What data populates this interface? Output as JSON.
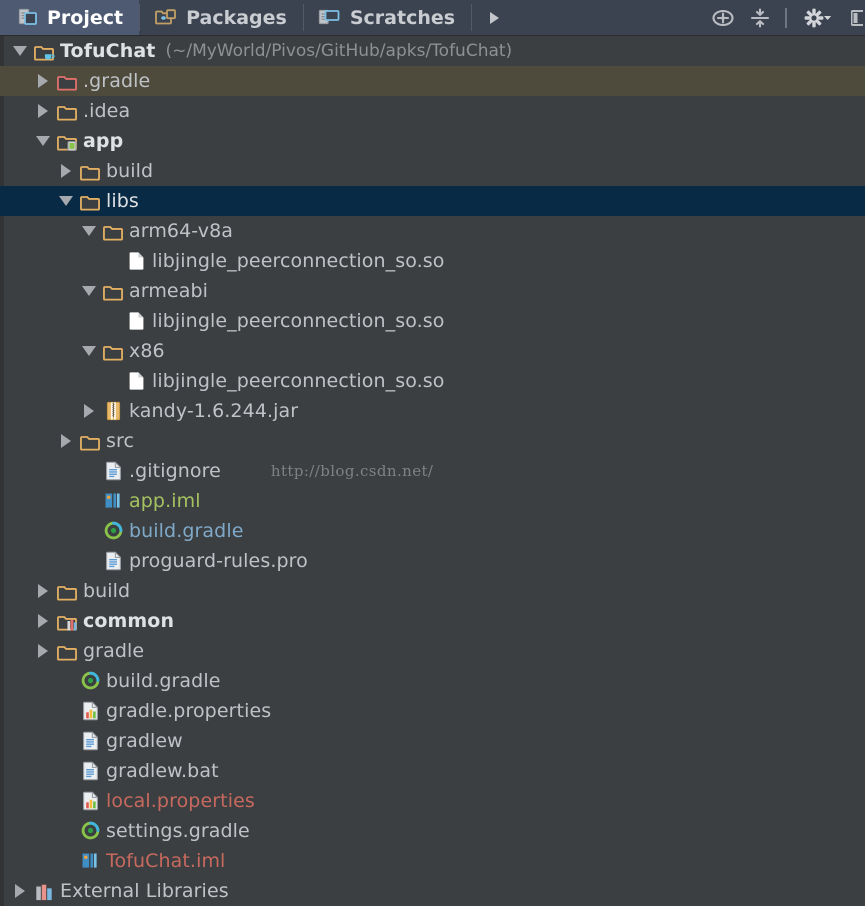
{
  "window": {
    "background": "#3c3f41",
    "selection_color": "#082a44",
    "hover_color": "#4e4b3d"
  },
  "tabs": [
    {
      "label": "Project",
      "icon": "project-panel-icon",
      "active": true
    },
    {
      "label": "Packages",
      "icon": "packages-panel-icon",
      "active": false
    },
    {
      "label": "Scratches",
      "icon": "scratches-panel-icon",
      "active": false
    }
  ],
  "tab_overflow": {
    "icon": "chevron-right-icon",
    "label": ""
  },
  "toolbar": [
    {
      "name": "locate-target-icon",
      "label": ""
    },
    {
      "name": "collapse-all-icon",
      "label": ""
    },
    {
      "name": "separator",
      "label": ""
    },
    {
      "name": "settings-gear-icon",
      "label": ""
    },
    {
      "name": "hide-panel-icon",
      "label": ""
    }
  ],
  "watermark": "http://blog.csdn.net/",
  "tree": [
    {
      "depth": 0,
      "twisty": "open",
      "icon": "project-module-icon",
      "label": "TofuChat",
      "bold": true,
      "color": "#dfe2e5",
      "note": "(~/MyWorld/Pivos/GitHub/apks/TofuChat)",
      "state": "normal"
    },
    {
      "depth": 1,
      "twisty": "closed",
      "icon": "folder-excluded-icon",
      "label": ".gradle",
      "bold": false,
      "color": "#bfc3c7",
      "note": "",
      "state": "hovered"
    },
    {
      "depth": 1,
      "twisty": "closed",
      "icon": "folder-icon",
      "label": ".idea",
      "bold": false,
      "color": "#bfc3c7",
      "note": "",
      "state": "normal"
    },
    {
      "depth": 1,
      "twisty": "open",
      "icon": "android-module-icon",
      "label": "app",
      "bold": true,
      "color": "#dfe2e5",
      "note": "",
      "state": "normal"
    },
    {
      "depth": 2,
      "twisty": "closed",
      "icon": "folder-icon",
      "label": "build",
      "bold": false,
      "color": "#bfc3c7",
      "note": "",
      "state": "normal"
    },
    {
      "depth": 2,
      "twisty": "open",
      "icon": "folder-icon",
      "label": "libs",
      "bold": false,
      "color": "#dfe2e5",
      "note": "",
      "state": "selected"
    },
    {
      "depth": 3,
      "twisty": "open",
      "icon": "folder-icon",
      "label": "arm64-v8a",
      "bold": false,
      "color": "#bfc3c7",
      "note": "",
      "state": "normal"
    },
    {
      "depth": 4,
      "twisty": "none",
      "icon": "file-blank-icon",
      "label": "libjingle_peerconnection_so.so",
      "bold": false,
      "color": "#bfc3c7",
      "note": "",
      "state": "normal"
    },
    {
      "depth": 3,
      "twisty": "open",
      "icon": "folder-icon",
      "label": "armeabi",
      "bold": false,
      "color": "#bfc3c7",
      "note": "",
      "state": "normal"
    },
    {
      "depth": 4,
      "twisty": "none",
      "icon": "file-blank-icon",
      "label": "libjingle_peerconnection_so.so",
      "bold": false,
      "color": "#bfc3c7",
      "note": "",
      "state": "normal"
    },
    {
      "depth": 3,
      "twisty": "open",
      "icon": "folder-icon",
      "label": "x86",
      "bold": false,
      "color": "#bfc3c7",
      "note": "",
      "state": "normal"
    },
    {
      "depth": 4,
      "twisty": "none",
      "icon": "file-blank-icon",
      "label": "libjingle_peerconnection_so.so",
      "bold": false,
      "color": "#bfc3c7",
      "note": "",
      "state": "normal"
    },
    {
      "depth": 3,
      "twisty": "closed",
      "icon": "jar-archive-icon",
      "label": "kandy-1.6.244.jar",
      "bold": false,
      "color": "#bfc3c7",
      "note": "",
      "state": "normal"
    },
    {
      "depth": 2,
      "twisty": "closed",
      "icon": "folder-icon",
      "label": "src",
      "bold": false,
      "color": "#bfc3c7",
      "note": "",
      "state": "normal"
    },
    {
      "depth": 3,
      "twisty": "none",
      "icon": "text-file-icon",
      "label": ".gitignore",
      "bold": false,
      "color": "#bfc3c7",
      "note": "",
      "state": "normal",
      "watermark": true
    },
    {
      "depth": 3,
      "twisty": "none",
      "icon": "iml-module-file-icon",
      "label": "app.iml",
      "bold": false,
      "color": "#a5c261",
      "note": "",
      "state": "normal"
    },
    {
      "depth": 3,
      "twisty": "none",
      "icon": "gradle-file-icon",
      "label": "build.gradle",
      "bold": false,
      "color": "#7fa9c9",
      "note": "",
      "state": "normal"
    },
    {
      "depth": 3,
      "twisty": "none",
      "icon": "text-file-icon",
      "label": "proguard-rules.pro",
      "bold": false,
      "color": "#bfc3c7",
      "note": "",
      "state": "normal"
    },
    {
      "depth": 1,
      "twisty": "closed",
      "icon": "folder-icon",
      "label": "build",
      "bold": false,
      "color": "#bfc3c7",
      "note": "",
      "state": "normal"
    },
    {
      "depth": 1,
      "twisty": "closed",
      "icon": "library-module-icon",
      "label": "common",
      "bold": true,
      "color": "#dfe2e5",
      "note": "",
      "state": "normal"
    },
    {
      "depth": 1,
      "twisty": "closed",
      "icon": "folder-icon",
      "label": "gradle",
      "bold": false,
      "color": "#bfc3c7",
      "note": "",
      "state": "normal"
    },
    {
      "depth": 2,
      "twisty": "none",
      "icon": "gradle-file-icon",
      "label": "build.gradle",
      "bold": false,
      "color": "#bfc3c7",
      "note": "",
      "state": "normal"
    },
    {
      "depth": 2,
      "twisty": "none",
      "icon": "properties-file-icon",
      "label": "gradle.properties",
      "bold": false,
      "color": "#bfc3c7",
      "note": "",
      "state": "normal"
    },
    {
      "depth": 2,
      "twisty": "none",
      "icon": "text-file-icon",
      "label": "gradlew",
      "bold": false,
      "color": "#bfc3c7",
      "note": "",
      "state": "normal"
    },
    {
      "depth": 2,
      "twisty": "none",
      "icon": "text-file-icon",
      "label": "gradlew.bat",
      "bold": false,
      "color": "#bfc3c7",
      "note": "",
      "state": "normal"
    },
    {
      "depth": 2,
      "twisty": "none",
      "icon": "properties-file-icon",
      "label": "local.properties",
      "bold": false,
      "color": "#c7695e",
      "note": "",
      "state": "normal"
    },
    {
      "depth": 2,
      "twisty": "none",
      "icon": "gradle-file-icon",
      "label": "settings.gradle",
      "bold": false,
      "color": "#bfc3c7",
      "note": "",
      "state": "normal"
    },
    {
      "depth": 2,
      "twisty": "none",
      "icon": "iml-module-file-icon",
      "label": "TofuChat.iml",
      "bold": false,
      "color": "#c7695e",
      "note": "",
      "state": "normal"
    },
    {
      "depth": 0,
      "twisty": "closed",
      "icon": "external-libraries-icon",
      "label": "External Libraries",
      "bold": false,
      "color": "#bfc3c7",
      "note": "",
      "state": "normal"
    }
  ]
}
